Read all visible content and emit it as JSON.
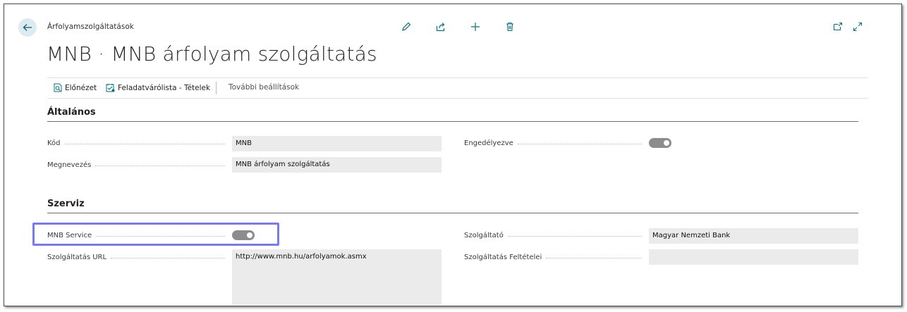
{
  "breadcrumb": "Árfolyamszolgáltatások",
  "page_title": "MNB · MNB árfolyam szolgáltatás",
  "action_bar": {
    "preview_label": "Előnézet",
    "queue_label": "Feladatvárólista - Tételek",
    "more_label": "További beállítások"
  },
  "sections": {
    "general": {
      "title": "Általános",
      "code_label": "Kód",
      "code_value": "MNB",
      "name_label": "Megnevezés",
      "name_value": "MNB árfolyam szolgáltatás",
      "enabled_label": "Engedélyezve",
      "enabled_value": true
    },
    "service": {
      "title": "Szerviz",
      "mnb_service_label": "MNB Service",
      "mnb_service_value": true,
      "url_label": "Szolgáltatás URL",
      "url_value": "http://www.mnb.hu/arfolyamok.asmx",
      "provider_label": "Szolgáltató",
      "provider_value": "Magyar Nemzeti Bank",
      "terms_label": "Szolgáltatás Feltételei",
      "terms_value": ""
    }
  },
  "colors": {
    "accent": "#7b7be6",
    "toggle_on": "#8c8c8c",
    "field_bg": "#ebebeb",
    "icon_teal": "#0e6e7a"
  }
}
